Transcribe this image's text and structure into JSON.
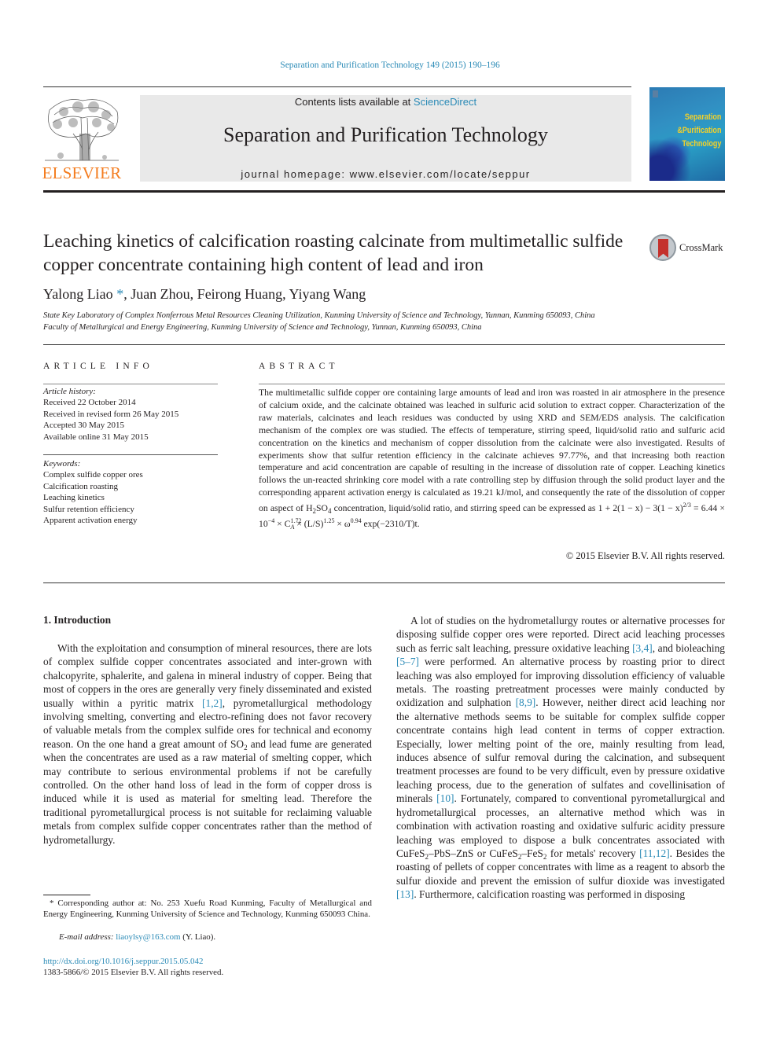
{
  "header": {
    "citation": "Separation and Purification Technology 149 (2015) 190–196",
    "contents_prefix": "Contents lists available at ",
    "contents_link": "ScienceDirect",
    "journal_name": "Separation and Purification Technology",
    "homepage_prefix": "journal homepage: ",
    "homepage_url": "www.elsevier.com/locate/seppur",
    "publisher_logo_text": "ELSEVIER",
    "cover_title_lines": [
      "Separation",
      "&Purification",
      "Technology"
    ]
  },
  "article": {
    "title": "Leaching kinetics of calcification roasting calcinate from multimetallic sulfide copper concentrate containing high content of lead and iron",
    "crossmark_label": "CrossMark",
    "authors": {
      "first": "Yalong Liao",
      "marker": "*",
      "rest": ", Juan Zhou, Feirong Huang, Yiyang Wang"
    },
    "affiliations": [
      "State Key Laboratory of Complex Nonferrous Metal Resources Cleaning Utilization, Kunming University of Science and Technology, Yunnan, Kunming 650093, China",
      "Faculty of Metallurgical and Energy Engineering, Kunming University of Science and Technology, Yunnan, Kunming 650093, China"
    ]
  },
  "article_info": {
    "heading": "ARTICLE INFO",
    "history_label": "Article history:",
    "history": [
      "Received 22 October 2014",
      "Received in revised form 26 May 2015",
      "Accepted 30 May 2015",
      "Available online 31 May 2015"
    ],
    "keywords_label": "Keywords:",
    "keywords": [
      "Complex sulfide copper ores",
      "Calcification roasting",
      "Leaching kinetics",
      "Sulfur retention efficiency",
      "Apparent activation energy"
    ]
  },
  "abstract": {
    "heading": "ABSTRACT",
    "text_1": "The multimetallic sulfide copper ore containing large amounts of lead and iron was roasted in air atmosphere in the presence of calcium oxide, and the calcinate obtained was leached in sulfuric acid solution to extract copper. Characterization of the raw materials, calcinates and leach residues was conducted by using XRD and SEM/EDS analysis. The calcification mechanism of the complex ore was studied. The effects of temperature, stirring speed, liquid/solid ratio and sulfuric acid concentration on the kinetics and mechanism of copper dissolution from the calcinate were also investigated. Results of experiments show that sulfur retention efficiency in the calcinate achieves 97.77%, and that increasing both reaction temperature and acid concentration are capable of resulting in the increase of dissolution rate of copper. Leaching kinetics follows the un-reacted shrinking core model with a rate controlling step by diffusion through the solid product layer and the corresponding apparent activation energy is calculated as 19.21 kJ/mol, and consequently the rate of the dissolution of copper on aspect of H",
    "h2so4_sub1": "2",
    "h2so4_mid": "SO",
    "h2so4_sub2": "4",
    "text_2": " concentration, liquid/solid ratio, and stirring speed can be expressed as ",
    "equation_lhs": "1 + 2(1 − x) − 3(1 − x)",
    "equation_exp": "2/3",
    "equation_rhs": " = 6.44 × 10",
    "equation_rhs_exp": "−4",
    "equation_times": " × C",
    "ca_sup": "1.72",
    "ca_sub": "A",
    "ls": " × (L/S)",
    "ls_exp": "1.25",
    "omega": " × ω",
    "omega_exp": "0.94",
    "tail": " exp(−2310/T)t.",
    "copyright": "© 2015 Elsevier B.V. All rights reserved."
  },
  "introduction": {
    "heading": "1. Introduction",
    "p1_a": "With the exploitation and consumption of mineral resources, there are lots of complex sulfide copper concentrates associated and inter-grown with chalcopyrite, sphalerite, and galena in mineral industry of copper. Being that most of coppers in the ores are generally very finely disseminated and existed usually within a pyritic matrix ",
    "p1_ref1": "[1,2]",
    "p1_b": ", pyrometallurgical methodology involving smelting, converting and electro-refining does not favor recovery of valuable metals from the complex sulfide ores for technical and economy reason. On the one hand a great amount of SO",
    "p1_sub": "2",
    "p1_c": " and lead fume are generated when the concentrates are used as a raw material of smelting copper, which may contribute to serious environmental problems if not be carefully controlled. On the other hand loss of lead in the form of copper dross is induced while it is used as material for smelting lead. Therefore the traditional pyrometallurgical process is not suitable for reclaiming valuable metals from complex sulfide copper concentrates rather than the method of hydrometallurgy.",
    "p2_a": "A lot of studies on the hydrometallurgy routes or alternative processes for disposing sulfide copper ores were reported. Direct acid leaching processes such as ferric salt leaching, pressure oxidative leaching ",
    "p2_ref1": "[3,4]",
    "p2_b": ", and bioleaching ",
    "p2_ref2": "[5–7]",
    "p2_c": " were performed. An alternative process by roasting prior to direct leaching was also employed for improving dissolution efficiency of valuable metals. The roasting pretreatment processes were mainly conducted by oxidization and sulphation ",
    "p2_ref3": "[8,9]",
    "p2_d": ". However, neither direct acid leaching nor the alternative methods seems to be suitable for complex sulfide copper concentrate contains high lead content in terms of copper extraction. Especially, lower melting point of the ore, mainly resulting from lead, induces absence of sulfur removal during the calcination, and subsequent treatment processes are found to be very difficult, even by pressure oxidative leaching process, due to the generation of sulfates and covellinisation of minerals ",
    "p2_ref4": "[10]",
    "p2_e": ". Fortunately, compared to conventional pyrometallurgical and hydrometallurgical processes, an alternative method which was in combination with activation roasting and oxidative sulfuric acidity pressure leaching was employed to dispose a bulk concentrates associated with CuFeS",
    "p2_sub1": "2",
    "p2_f": "–PbS–ZnS or CuFeS",
    "p2_sub2": "2",
    "p2_g": "–FeS",
    "p2_sub3": "2",
    "p2_h": " for metals' recovery ",
    "p2_ref5": "[11,12]",
    "p2_i": ". Besides the roasting of pellets of copper concentrates with lime as a reagent to absorb the sulfur dioxide and prevent the emission of sulfur dioxide was investigated ",
    "p2_ref6": "[13]",
    "p2_j": ". Furthermore, calcification roasting was performed in disposing"
  },
  "footnote": {
    "marker": "*",
    "text": " Corresponding author at: No. 253 Xuefu Road Kunming, Faculty of Metallurgical and Energy Engineering, Kunming University of Science and Technology, Kunming 650093 China.",
    "email_label": "E-mail address: ",
    "email": "liaoylsy@163.com",
    "email_suffix": " (Y. Liao).",
    "doi": "http://dx.doi.org/10.1016/j.seppur.2015.05.042",
    "issn_copyright": "1383-5866/© 2015 Elsevier B.V. All rights reserved."
  }
}
